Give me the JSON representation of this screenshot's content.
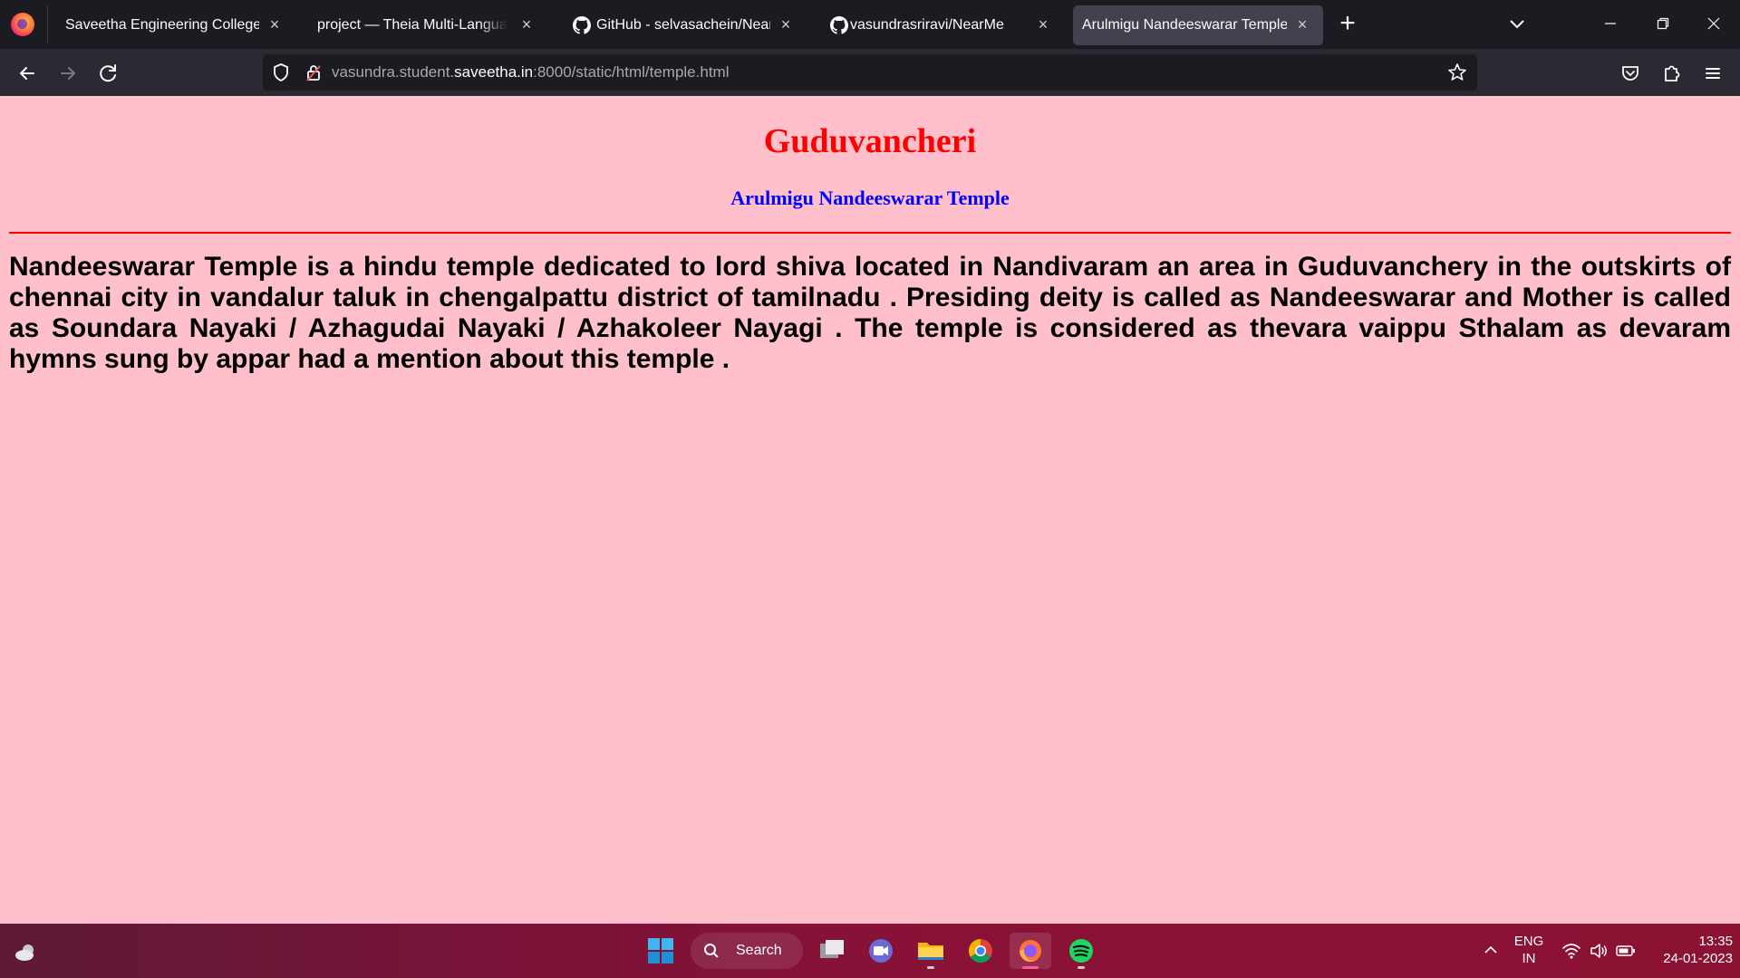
{
  "browser": {
    "tabs": [
      {
        "title": "Saveetha Engineering College",
        "icon": "none",
        "active": false
      },
      {
        "title": "project — Theia Multi-Language Explorer",
        "icon": "none",
        "active": false
      },
      {
        "title": "GitHub - selvasachein/NearMe",
        "icon": "github-icon",
        "active": false
      },
      {
        "title": "vasundrasriravi/NearMe",
        "icon": "github-icon",
        "active": false
      },
      {
        "title": "Arulmigu Nandeeswarar Temple",
        "icon": "none",
        "active": true
      }
    ],
    "url": {
      "prefix": "vasundra.student.",
      "host": "saveetha.in",
      "suffix": ":8000/static/html/temple.html"
    }
  },
  "page": {
    "heading": "Guduvancheri",
    "subheading": "Arulmigu Nandeeswarar Temple",
    "paragraph": "Nandeeswarar Temple is a hindu temple dedicated to lord shiva located in Nandivaram an area in Guduvanchery in the outskirts of chennai city in vandalur taluk in chengalpattu district of tamilnadu . Presiding deity is called as Nandeeswarar and Mother is called as Soundara Nayaki / Azhagudai Nayaki / Azhakoleer Nayagi . The temple is considered as thevara vaippu Sthalam as devaram hymns sung by appar had a mention about this temple .",
    "colors": {
      "background": "#ffc0cb",
      "heading": "#ff0000",
      "subheading": "#0000ff",
      "rule": "#ff0000"
    }
  },
  "taskbar": {
    "search_label": "Search",
    "apps": [
      "windows-start-icon",
      "task-view-icon",
      "teams-chat-icon",
      "file-explorer-icon",
      "chrome-icon",
      "firefox-icon",
      "spotify-icon"
    ],
    "lang_line1": "ENG",
    "lang_line2": "IN",
    "time": "13:35",
    "date": "24-01-2023"
  }
}
